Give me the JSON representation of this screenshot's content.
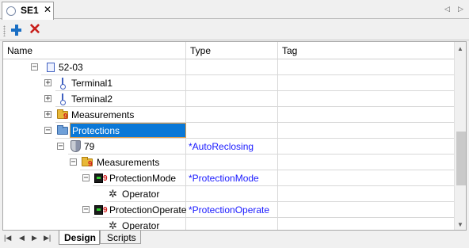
{
  "tab": {
    "title": "SE1",
    "close_glyph": "✕"
  },
  "tab_nav": {
    "left": "◁",
    "right": "▷"
  },
  "toolbar": {
    "add_icon": "plus-icon",
    "delete_icon": "red-x-icon",
    "delete_glyph": "✕"
  },
  "grid": {
    "columns": [
      "Name",
      "Type",
      "Tag"
    ],
    "rows": [
      {
        "name": "52-03",
        "type": "",
        "tag": "",
        "expander": "−",
        "icon": "bay-icon"
      },
      {
        "name": "Terminal1",
        "type": "",
        "tag": "",
        "expander": "+",
        "icon": "terminal-icon"
      },
      {
        "name": "Terminal2",
        "type": "",
        "tag": "",
        "expander": "+",
        "icon": "terminal-icon"
      },
      {
        "name": "Measurements",
        "type": "",
        "tag": "",
        "expander": "+",
        "icon": "measurements-folder-icon",
        "badge": "9"
      },
      {
        "name": "Protections",
        "type": "",
        "tag": "",
        "expander": "−",
        "icon": "protections-folder-icon",
        "selected": true
      },
      {
        "name": "79",
        "type": "*AutoReclosing",
        "tag": "",
        "expander": "−",
        "icon": "shield-icon"
      },
      {
        "name": "Measurements",
        "type": "",
        "tag": "",
        "expander": "−",
        "icon": "measurements-folder-icon",
        "badge": "9"
      },
      {
        "name": "ProtectionMode",
        "type": "*ProtectionMode",
        "tag": "",
        "expander": "−",
        "icon": "monitor-icon",
        "badge": "9"
      },
      {
        "name": "Operator",
        "type": "",
        "tag": "",
        "icon": "gear-icon"
      },
      {
        "name": "ProtectionOperate",
        "type": "*ProtectionOperate",
        "tag": "",
        "expander": "−",
        "icon": "monitor-icon",
        "badge": "9"
      },
      {
        "name": "Operator",
        "type": "",
        "tag": "",
        "icon": "gear-icon"
      }
    ]
  },
  "scrollbar": {
    "up": "▲",
    "down": "▼"
  },
  "bottom_nav": {
    "first": "|◀",
    "prev": "◀",
    "next": "▶",
    "last": "▶|"
  },
  "bottom_tabs": [
    {
      "label": "Design",
      "active": true
    },
    {
      "label": "Scripts",
      "active": false
    }
  ],
  "colors": {
    "selection": "#0a78d7",
    "type_text": "#1a1aff",
    "delete": "#c8201c",
    "add": "#1a6fc4"
  }
}
